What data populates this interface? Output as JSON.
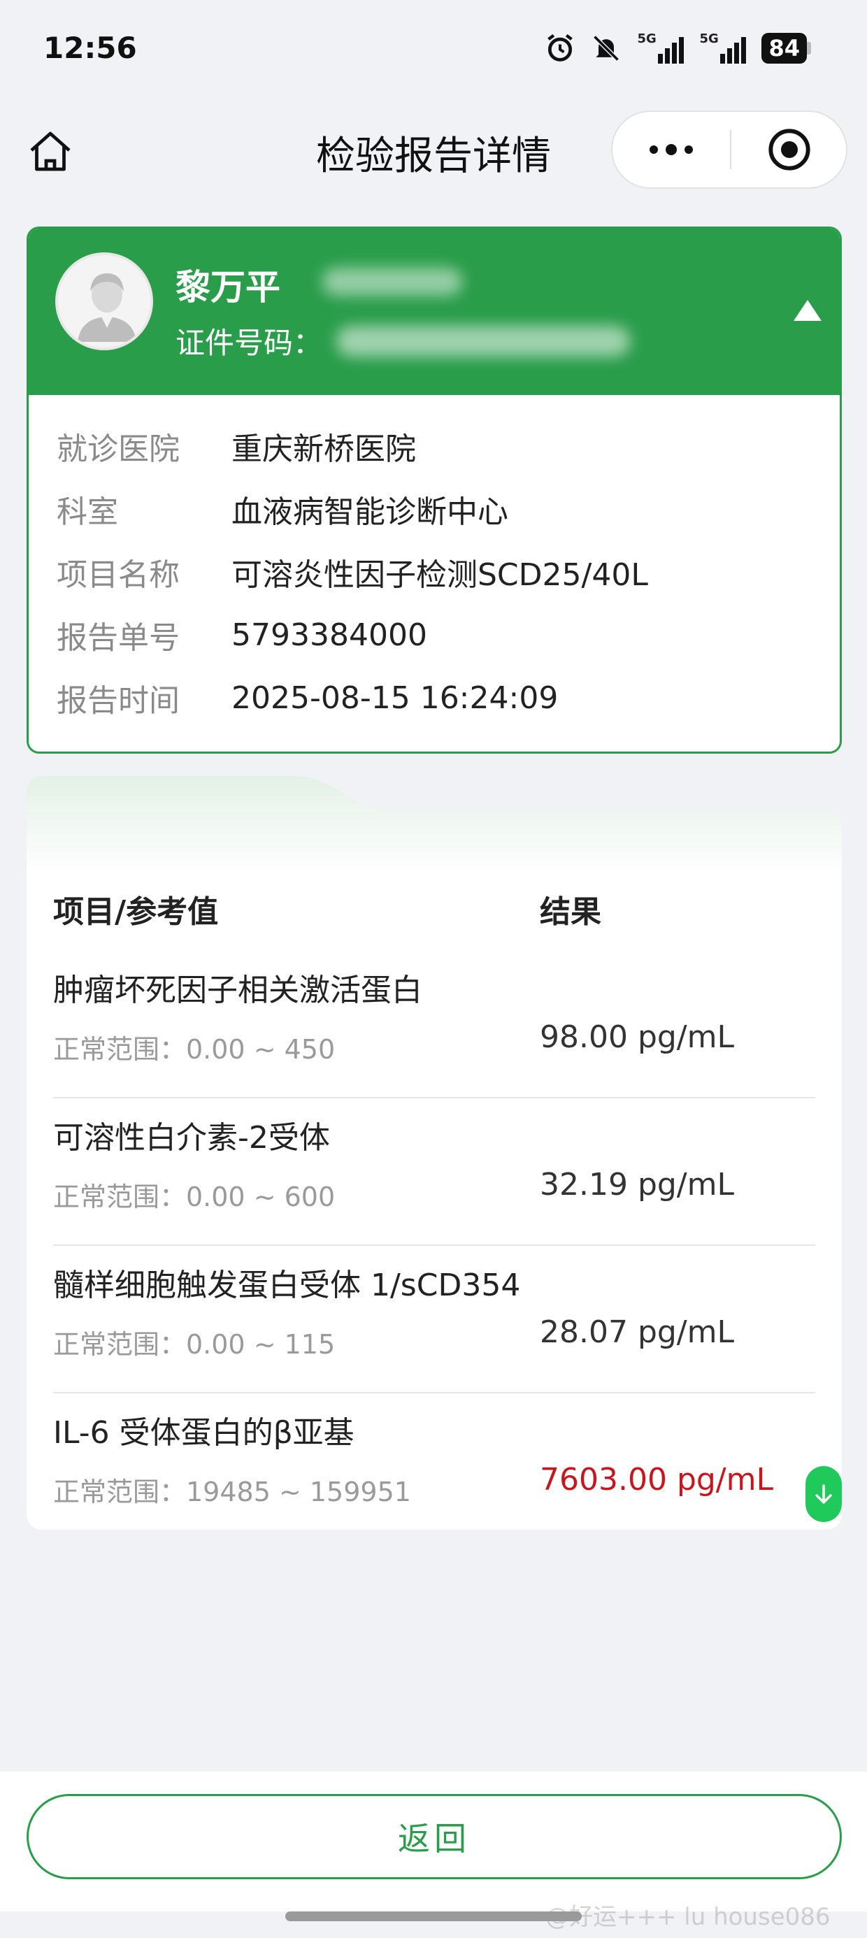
{
  "status_bar": {
    "time": "12:56",
    "battery": "84",
    "signal_1": "5G",
    "signal_2": "5G"
  },
  "nav": {
    "title": "检验报告详情"
  },
  "patient": {
    "name": "黎万平",
    "id_label": "证件号码：",
    "info": [
      {
        "label": "就诊医院",
        "value": "重庆新桥医院"
      },
      {
        "label": "科室",
        "value": "血液病智能诊断中心"
      },
      {
        "label": "项目名称",
        "value": "可溶炎性因子检测SCD25/40L"
      },
      {
        "label": "报告单号",
        "value": "5793384000"
      },
      {
        "label": "报告时间",
        "value": "2025-08-15 16:24:09"
      }
    ]
  },
  "results": {
    "header_item": "项目/参考值",
    "header_result": "结果",
    "rows": [
      {
        "name": "肿瘤坏死因子相关激活蛋白",
        "range": "正常范围：0.00 ~ 450",
        "result": "98.00 pg/mL",
        "abnormal": false
      },
      {
        "name": "可溶性白介素-2受体",
        "range": "正常范围：0.00 ~ 600",
        "result": "32.19 pg/mL",
        "abnormal": false
      },
      {
        "name": "髓样细胞触发蛋白受体 1/sCD354",
        "range": "正常范围：0.00 ~ 115",
        "result": "28.07 pg/mL",
        "abnormal": false
      },
      {
        "name": "IL-6 受体蛋白的β亚基",
        "range": "正常范围：19485 ~ 159951",
        "result": "7603.00 pg/mL",
        "abnormal": true
      }
    ]
  },
  "footer": {
    "back_label": "返回",
    "watermark": "@好运+++ lu house086"
  },
  "colors": {
    "brand_green": "#2a9d4b",
    "abnormal_red": "#c7161e",
    "flag_green": "#1fc95a"
  }
}
